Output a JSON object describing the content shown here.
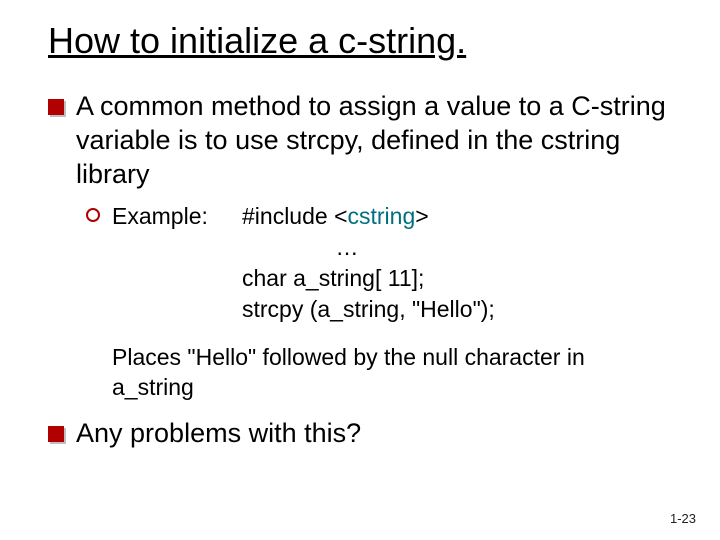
{
  "title": "How to initialize a c-string.",
  "bullets": [
    {
      "text": "A common method to assign a value to a C-string variable is to use strcpy, defined in the cstring library"
    },
    {
      "text": "Any problems with this?"
    }
  ],
  "example": {
    "label": "Example:",
    "code": {
      "line1a": "#include <",
      "line1b": "cstring",
      "line1c": ">",
      "line2": "…",
      "line3": "char a_string[ 11];",
      "line4": "strcpy (a_string, \"Hello\");"
    },
    "note": "Places \"Hello\" followed by the null character in a_string"
  },
  "pageNumber": "1-23"
}
